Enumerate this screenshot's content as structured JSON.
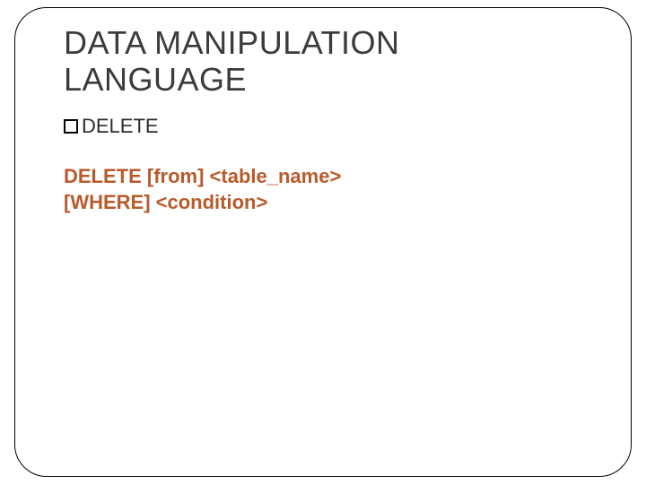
{
  "title": "DATA MANIPULATION LANGUAGE",
  "bullet": "DELETE",
  "code_line1": "DELETE [from] <table_name>",
  "code_line2": "[WHERE] <condition>"
}
